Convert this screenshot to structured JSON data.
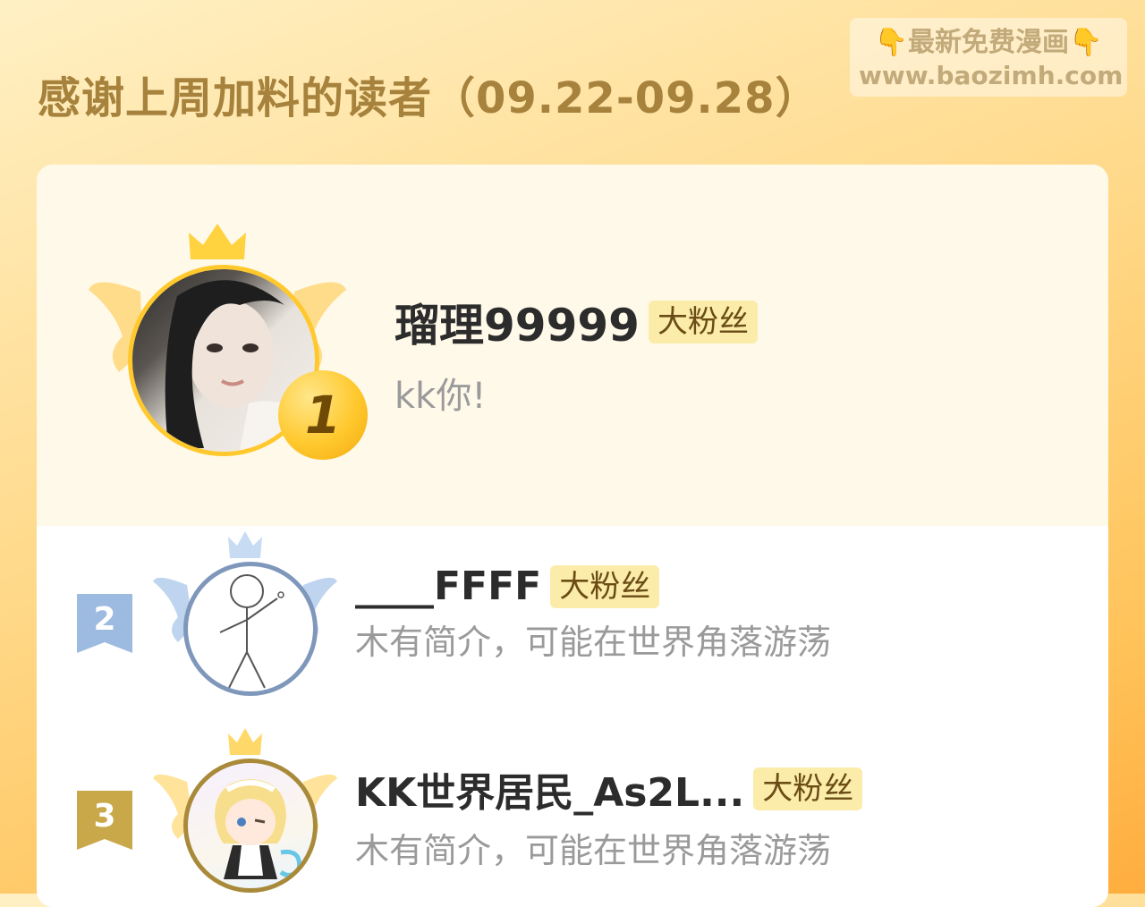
{
  "header": {
    "title": "感谢上周加料的读者（09.22-09.28）"
  },
  "watermark": {
    "line1_left_icon": "👇",
    "line1_text": "最新免费漫画",
    "line1_right_icon": "👇",
    "line2_text": "www.baozimh.com"
  },
  "readers": [
    {
      "rank": "1",
      "name": "瑠理99999",
      "badge": "大粉丝",
      "bio": "kk你!",
      "avatar_icon": "girl-photo-avatar",
      "medal_color": "#ffc92e"
    },
    {
      "rank": "2",
      "name": "____FFFF",
      "badge": "大粉丝",
      "bio": "木有简介，可能在世界角落游荡",
      "avatar_icon": "stick-figure-avatar",
      "ring_color": "#7f97bb"
    },
    {
      "rank": "3",
      "name": "KK世界居民_As2L...",
      "badge": "大粉丝",
      "bio": "木有简介，可能在世界角落游荡",
      "avatar_icon": "anime-maid-avatar",
      "ring_color": "#a88a3a"
    }
  ],
  "colors": {
    "gold": "#ffc92e",
    "silver": "#8fb0d8",
    "bronze": "#c9a84a",
    "badge_bg": "#fbecaa"
  }
}
